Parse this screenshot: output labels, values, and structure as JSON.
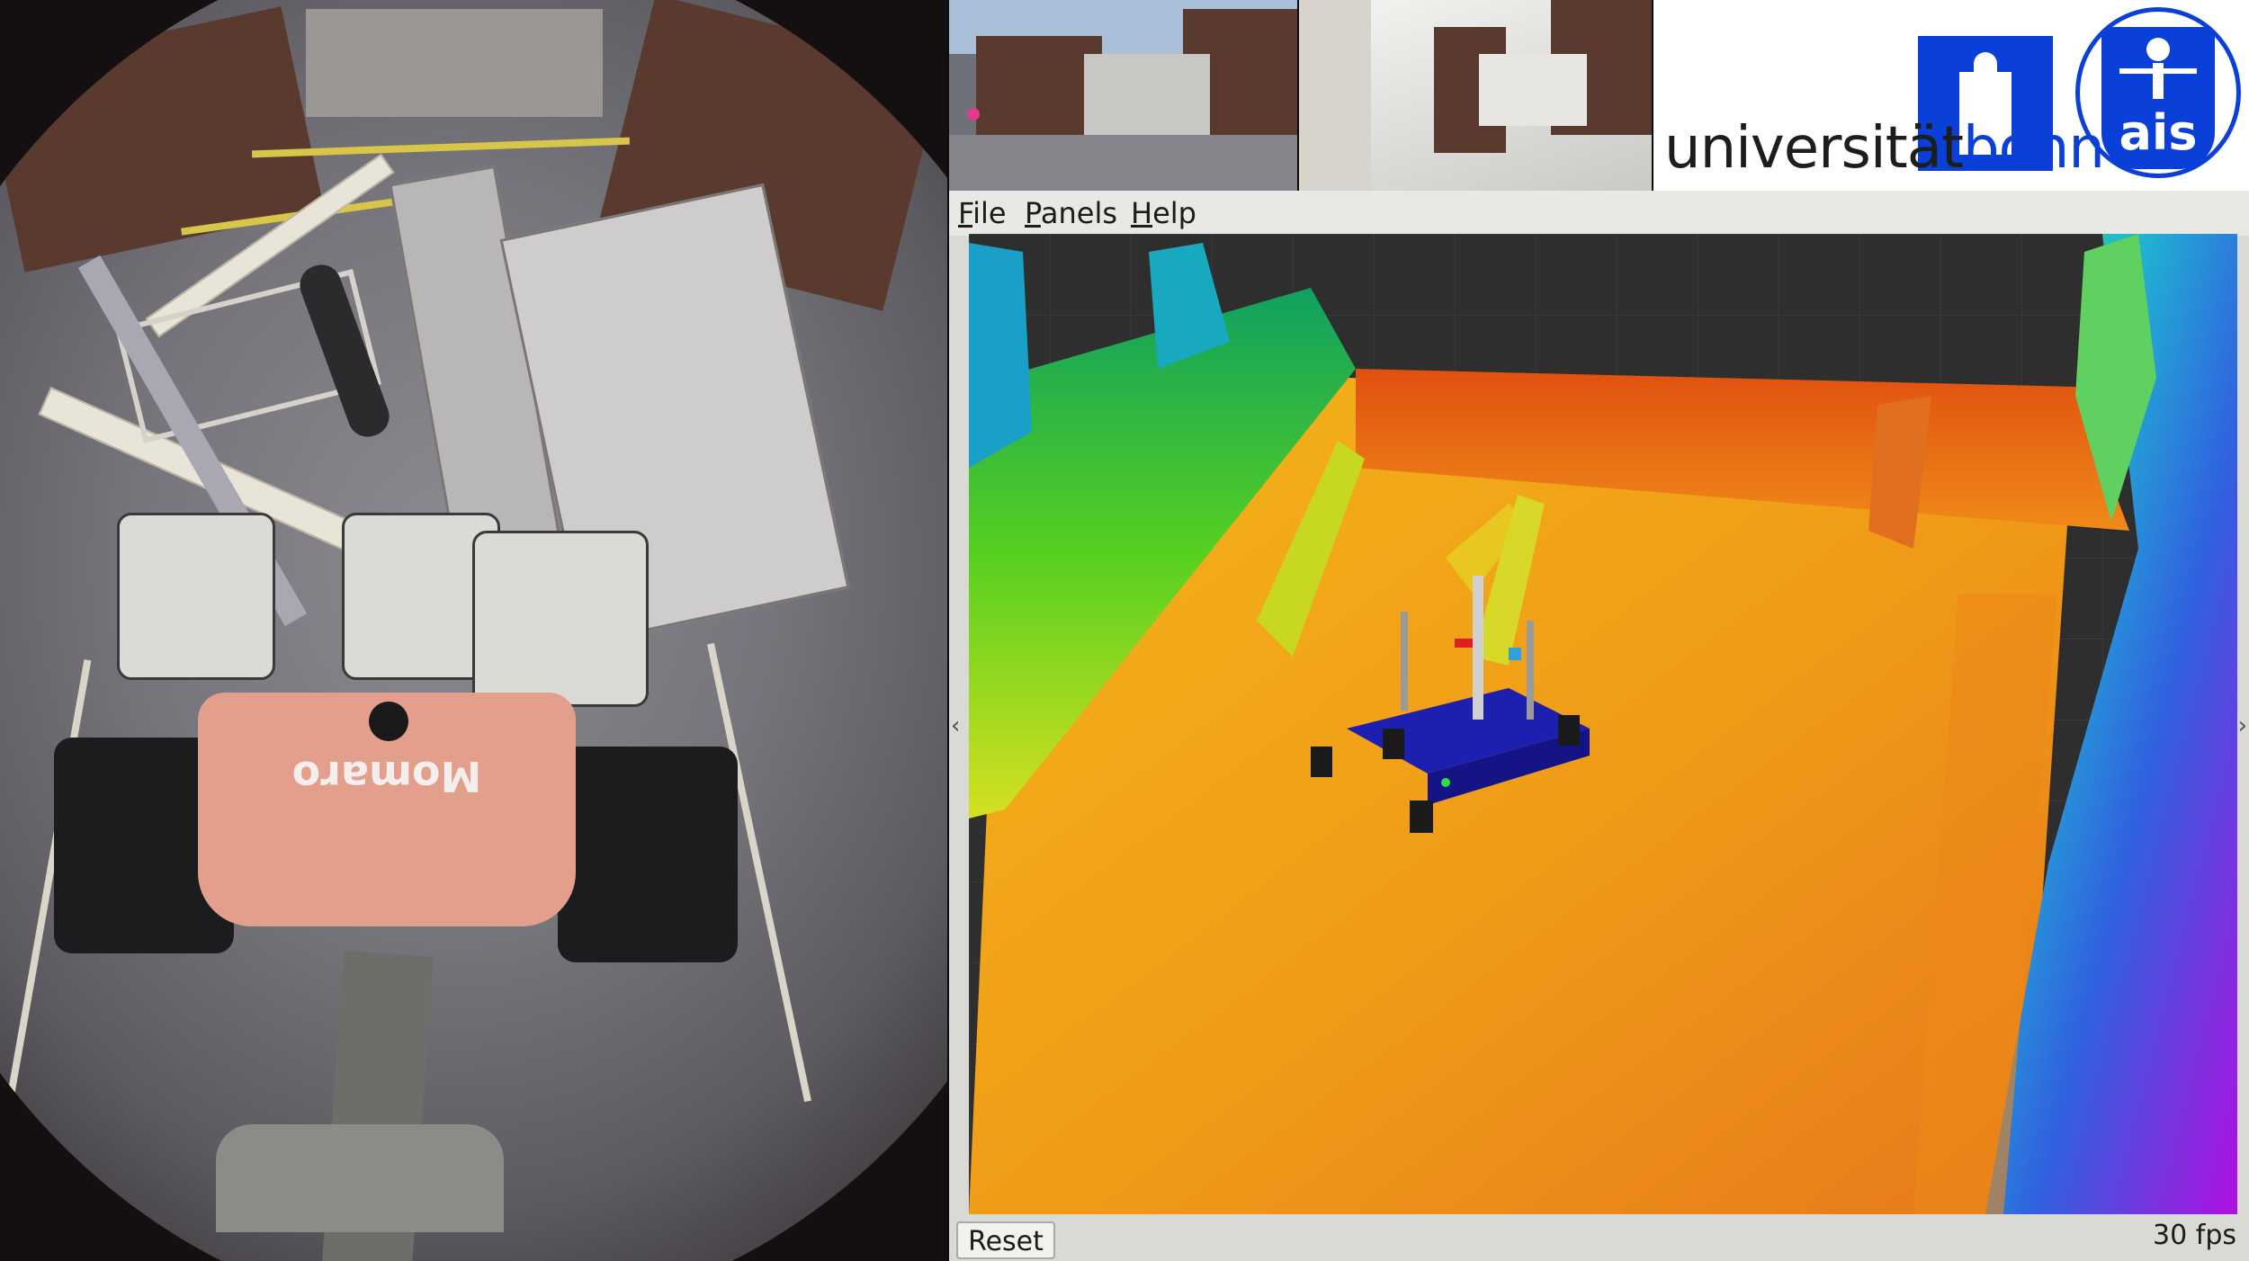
{
  "rviz": {
    "menu": [
      {
        "label": "File",
        "accel": "F",
        "rest": "ile"
      },
      {
        "label": "Panels",
        "accel": "P",
        "rest": "anels"
      },
      {
        "label": "Help",
        "accel": "H",
        "rest": "elp"
      }
    ],
    "reset_label": "Reset",
    "fps_text": "30 fps",
    "collapse_left_arrow": "‹",
    "collapse_right_arrow": "›"
  },
  "logos": {
    "university_prefix": "universität",
    "university_suffix": "bonn",
    "lab": "ais",
    "brand_blue": "#0a3fd8"
  },
  "robot": {
    "body_label": "Momaro"
  },
  "colors": {
    "pointcloud_floor": "#f0a020",
    "pointcloud_wall_green": "#39d040",
    "pointcloud_wall_purple": "#8a20e0",
    "robot_model": "#1d1fb0"
  }
}
